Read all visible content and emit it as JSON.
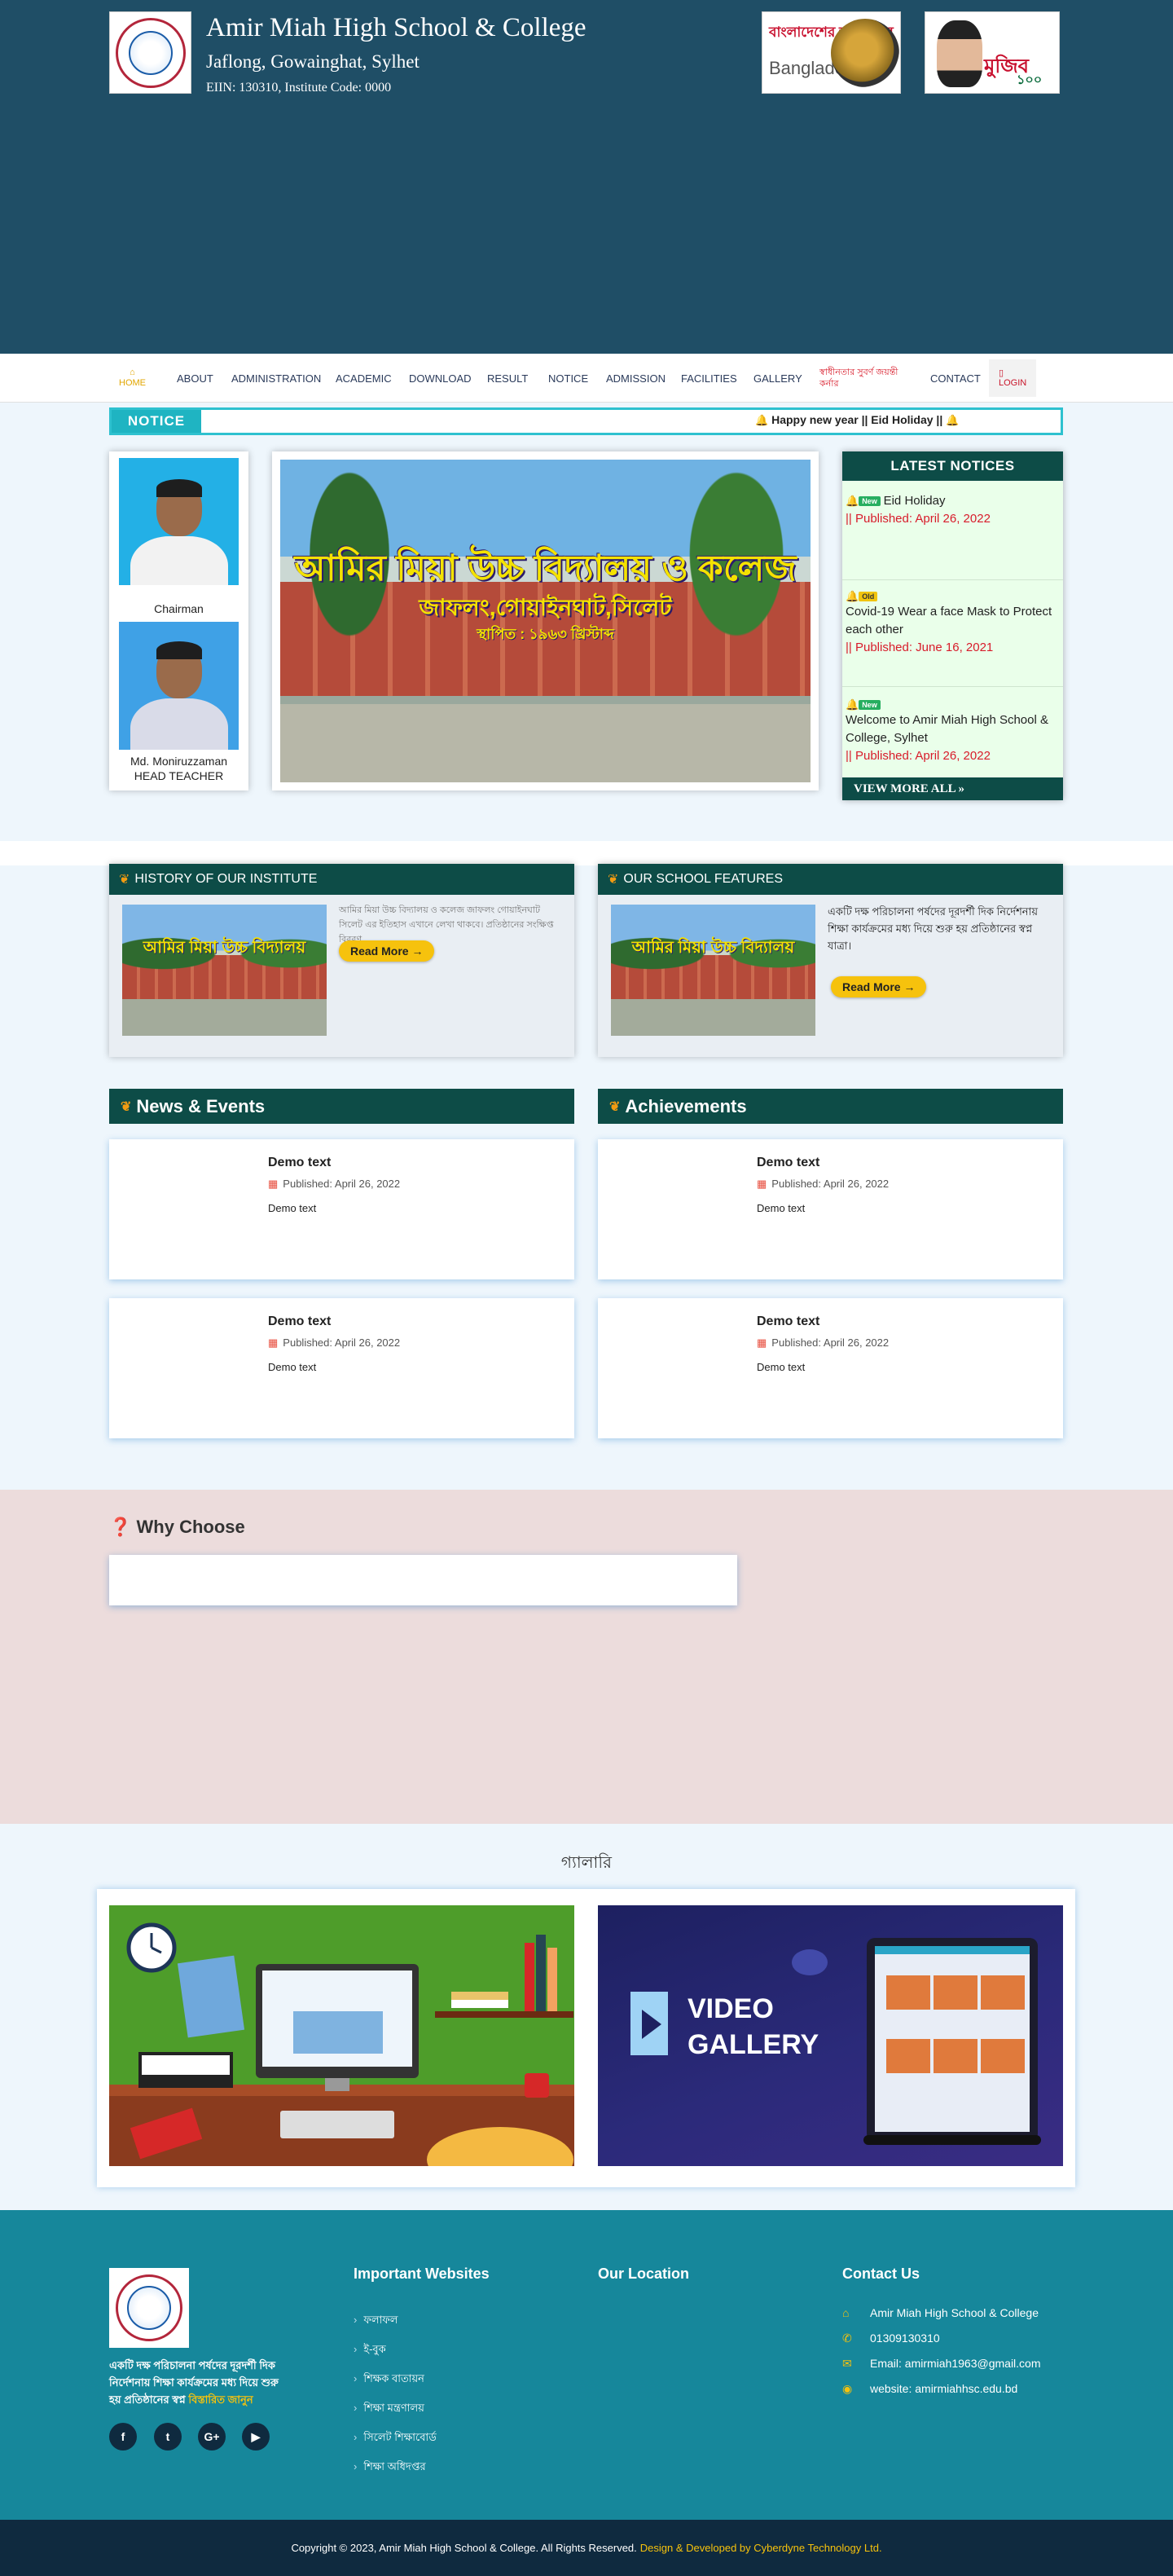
{
  "header": {
    "school_name": "Amir Miah High School & College",
    "address": "Jaflong, Gowainghat, Sylhet",
    "eiin": "EIIN: 130310, Institute Code: 0000",
    "banner1_text1": "বাংলাদেশের স্বাধীনতার",
    "banner1_text2": "Bangladesh",
    "banner2_text1": "মুজিব",
    "banner2_text2": "১০০"
  },
  "nav": {
    "items": [
      "HOME",
      "ABOUT",
      "ADMINISTRATION",
      "ACADEMIC",
      "DOWNLOAD",
      "RESULT",
      "NOTICE",
      "ADMISSION",
      "FACILITIES",
      "GALLERY",
      "স্বাধীনতার সুবর্ণ জয়ন্তী কর্নার",
      "CONTACT",
      "LOGIN"
    ]
  },
  "notice": {
    "label": "NOTICE",
    "ticker": "Happy new year ||   Eid Holiday ||"
  },
  "leaders": {
    "chairman_caption": "Chairman",
    "head_name": "Md. Moniruzzaman",
    "head_title": "HEAD TEACHER"
  },
  "hero": {
    "line1": "আমির মিয়া উচ্চ বিদ্যালয় ও কলেজ",
    "line2": "জাফলং,গোয়াইনঘাট,সিলেট",
    "line3": "স্থাপিত : ১৯৬৩ খ্রিস্টাব্দ"
  },
  "latest_notices": {
    "title": "LATEST NOTICES",
    "items": [
      {
        "badge": "New",
        "title": "Eid Holiday",
        "date": "Published: April 26, 2022"
      },
      {
        "badge": "Old",
        "title": "Covid-19 Wear a face Mask to Protect each other",
        "date": "Published: June 16, 2021"
      },
      {
        "badge": "New",
        "title": "Welcome to Amir Miah High School & College, Sylhet",
        "date": "Published: April 26, 2022"
      }
    ],
    "view_more": "VIEW MORE ALL »"
  },
  "history": {
    "title": "HISTORY OF OUR INSTITUTE",
    "text": "আমির মিয়া উচ্চ বিদ্যালয় ও কলেজ জাফলং গোয়াইনঘাট সিলেট এর ইতিহাস এখানে লেখা থাকবে। প্রতিষ্ঠানের সংক্ষিপ্ত বিবরণ",
    "read_more": "Read More →",
    "thumb_text": "আমির মিয়া উচ্চ বিদ্যালয়"
  },
  "features": {
    "title": "OUR SCHOOL FEATURES",
    "text": "একটি দক্ষ পরিচালনা পর্ষদের দূরদর্শী দিক নির্দেশনায় শিক্ষা কার্যক্রমের মধ্য দিয়ে শুরু হয় প্রতিষ্ঠানের স্বপ্ন যাত্রা।",
    "read_more": "Read More →",
    "thumb_text": "আমির মিয়া উচ্চ বিদ্যালয়"
  },
  "news": {
    "title": "News & Events",
    "cards": [
      {
        "title": "Demo text",
        "date": "Published: April 26, 2022",
        "body": "Demo text"
      },
      {
        "title": "Demo text",
        "date": "Published: April 26, 2022",
        "body": "Demo text"
      }
    ]
  },
  "achievements": {
    "title": "Achievements",
    "cards": [
      {
        "title": "Demo text",
        "date": "Published: April 26, 2022",
        "body": "Demo text"
      },
      {
        "title": "Demo text",
        "date": "Published: April 26, 2022",
        "body": "Demo text"
      }
    ]
  },
  "why": {
    "title": "Why Choose"
  },
  "gallery": {
    "title": "গ্যালারি",
    "video_line1": "VIDEO",
    "video_line2": "GALLERY"
  },
  "footer": {
    "about": "একটি দক্ষ পরিচালনা পর্ষদের দূরদর্শী দিক নির্দেশনায় শিক্ষা কার্যক্রমের মধ্য দিয়ে শুরু হয় প্রতিষ্ঠানের স্বপ্ন",
    "about_more": "বিস্তারিত জানুন",
    "links_title": "Important Websites",
    "links": [
      "ফলাফল",
      "ই-বুক",
      "শিক্ষক বাতায়ন",
      "শিক্ষা মন্ত্রণালয়",
      "সিলেট শিক্ষাবোর্ড",
      "শিক্ষা অধিদপ্তর"
    ],
    "location_title": "Our Location",
    "contact_title": "Contact Us",
    "contacts": [
      "Amir Miah High School & College",
      "01309130310",
      "Email: amirmiah1963@gmail.com",
      "website: amirmiahhsc.edu.bd"
    ],
    "social": [
      "f",
      "t",
      "G+",
      "▶"
    ],
    "copyright": "Copyright © 2023, Amir Miah High School & College. All Rights Reserved.",
    "developer": "Design & Developed by Cyberdyne Technology Ltd."
  },
  "colors": {
    "header_bg": "#1f4e66",
    "dark_green": "#0d4c47",
    "notice_cyan": "#1fb4c2",
    "accent_yellow": "#f6c20d",
    "footer_bg": "#16879b",
    "bottom_bar": "#0f2a3f"
  }
}
